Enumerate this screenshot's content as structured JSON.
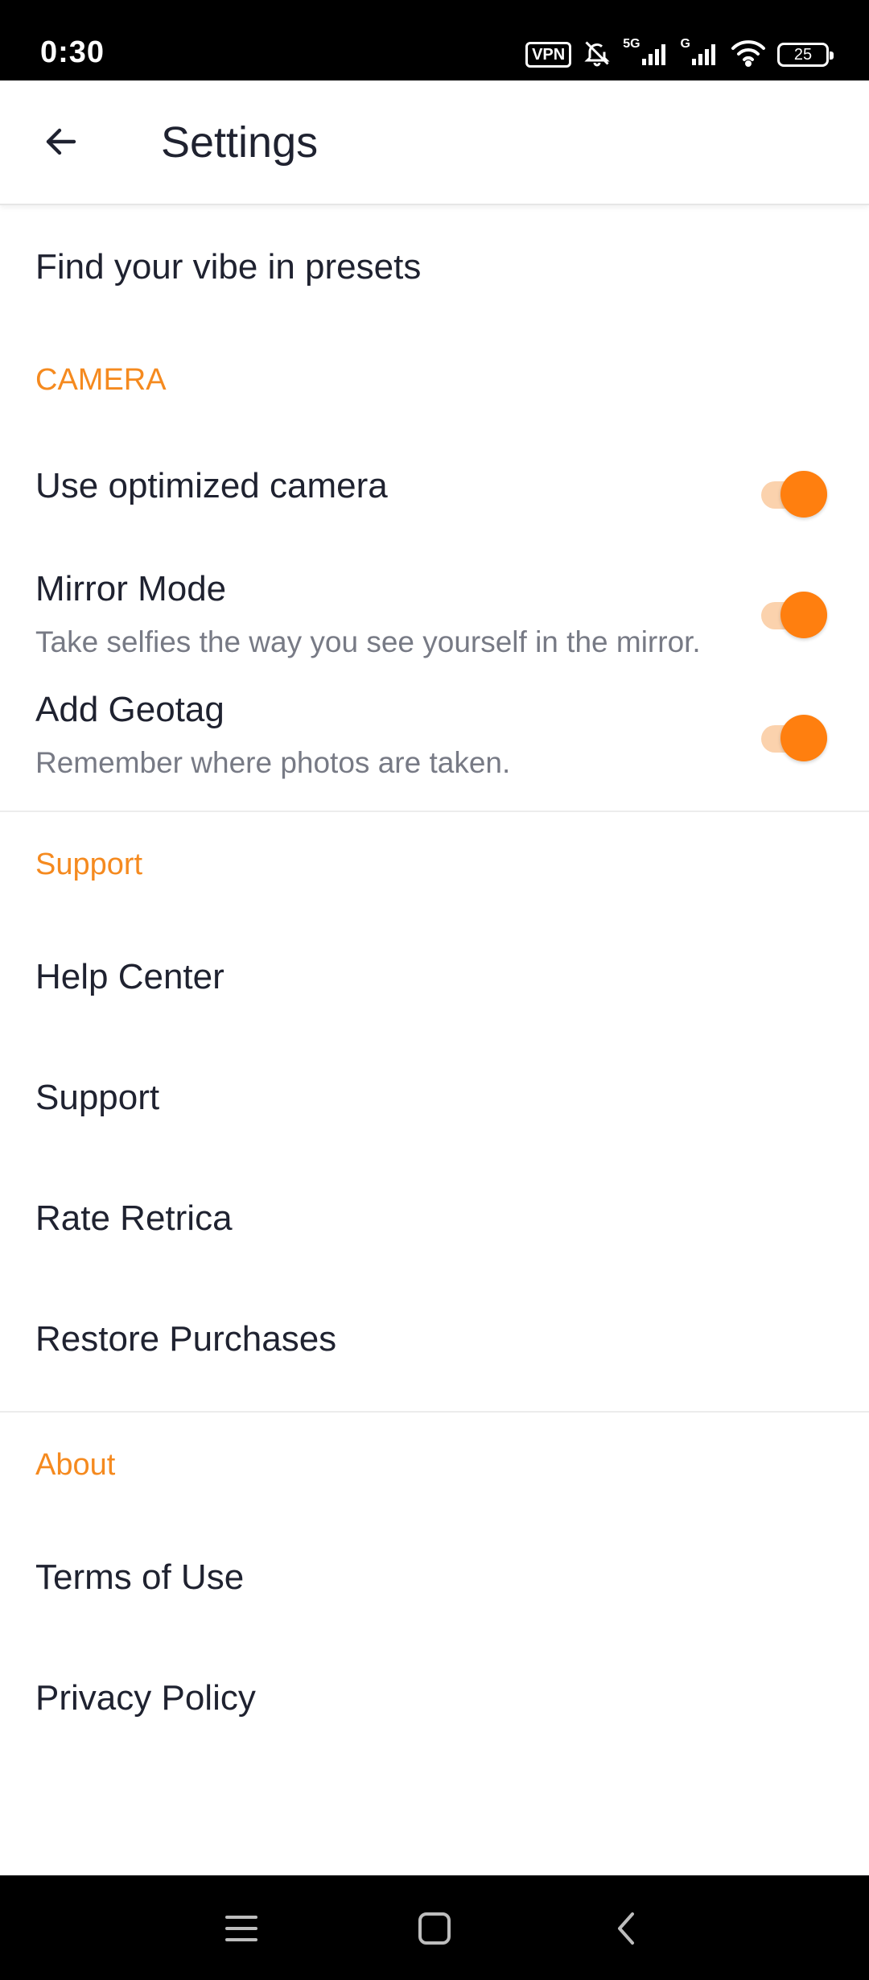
{
  "status_bar": {
    "time": "0:30",
    "vpn": "VPN",
    "net1": "5G",
    "net2": "G",
    "battery": "25"
  },
  "app_bar": {
    "title": "Settings",
    "back_icon": "arrow-back-icon"
  },
  "items": {
    "presets": "Find your vibe in presets"
  },
  "camera": {
    "header": "CAMERA",
    "optimized": {
      "label": "Use optimized camera",
      "on": true
    },
    "mirror": {
      "label": "Mirror Mode",
      "sub": "Take selfies the way you see yourself in the mirror.",
      "on": true
    },
    "geotag": {
      "label": "Add Geotag",
      "sub": "Remember where photos are taken.",
      "on": true
    }
  },
  "support": {
    "header": "Support",
    "items": [
      "Help Center",
      "Support",
      "Rate Retrica",
      "Restore Purchases"
    ]
  },
  "about": {
    "header": "About",
    "items": [
      "Terms of Use",
      "Privacy Policy"
    ]
  },
  "colors": {
    "accent": "#ff7f0f",
    "header_text": "#f58a1f",
    "track": "#fbd2ad"
  },
  "nav": {
    "menu_icon": "menu-icon",
    "home_icon": "home-icon",
    "back_icon": "back-chevron-icon"
  }
}
